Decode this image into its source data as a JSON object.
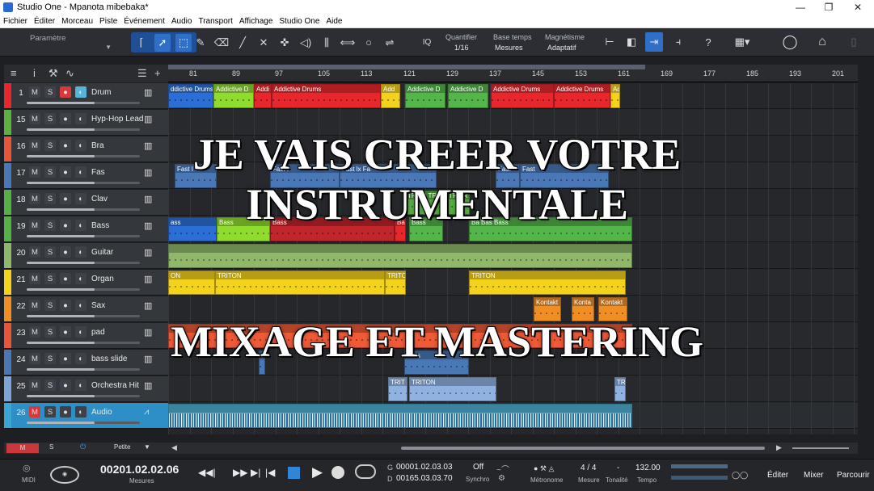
{
  "window": {
    "title": "Studio One - Mpanota mibebaka*",
    "min": "—",
    "max": "❐",
    "close": "✕"
  },
  "menu": [
    "Fichier",
    "Éditer",
    "Morceau",
    "Piste",
    "Événement",
    "Audio",
    "Transport",
    "Affichage",
    "Studio One",
    "Aide"
  ],
  "toolbar": {
    "param_label": "Paramètre",
    "quantize_label": "Quantifier",
    "quantize_value": "1/16",
    "timebase_label": "Base temps",
    "timebase_value": "Mesures",
    "snap_label": "Magnétisme",
    "snap_value": "Adaptatif",
    "iq_label": "IQ"
  },
  "ruler": [
    "81",
    "89",
    "97",
    "105",
    "113",
    "121",
    "129",
    "137",
    "145",
    "153",
    "161",
    "169",
    "177",
    "185",
    "193",
    "201"
  ],
  "tracks": [
    {
      "num": "1",
      "name": "Drum",
      "color": "#e8272d",
      "rec": true,
      "mon": true
    },
    {
      "num": "15",
      "name": "Hyp-Hop Lead",
      "color": "#5fb13f",
      "rec": false,
      "mon": false
    },
    {
      "num": "16",
      "name": "Bra",
      "color": "#e8563a",
      "rec": false,
      "mon": false
    },
    {
      "num": "17",
      "name": "Fas",
      "color": "#4a78b6",
      "rec": false,
      "mon": false
    },
    {
      "num": "18",
      "name": "Clav",
      "color": "#57b044",
      "rec": false,
      "mon": false
    },
    {
      "num": "19",
      "name": "Bass",
      "color": "#57b044",
      "rec": false,
      "mon": false
    },
    {
      "num": "20",
      "name": "Guitar",
      "color": "#8fb86a",
      "rec": false,
      "mon": false
    },
    {
      "num": "21",
      "name": "Organ",
      "color": "#f3d21b",
      "rec": false,
      "mon": false
    },
    {
      "num": "22",
      "name": "Sax",
      "color": "#f08e24",
      "rec": false,
      "mon": false
    },
    {
      "num": "23",
      "name": "pad",
      "color": "#e8563a",
      "rec": false,
      "mon": false
    },
    {
      "num": "24",
      "name": "bass slide",
      "color": "#4a78b6",
      "rec": false,
      "mon": false
    },
    {
      "num": "25",
      "name": "Orchestra Hit",
      "color": "#7ea4d6",
      "rec": false,
      "mon": false
    },
    {
      "num": "26",
      "name": "Audio",
      "color": "#3aa6d2",
      "rec": false,
      "mon": false,
      "selected": true
    }
  ],
  "track_buttons": {
    "mute": "M",
    "solo": "S",
    "record": "●",
    "monitor": "◐"
  },
  "clips": [
    {
      "lane": 0,
      "items": [
        {
          "label": "ddictive Drums",
          "color": "#2b6fd6"
        },
        {
          "label": "Addictive D",
          "color": "#8fdb2e"
        },
        {
          "label": "Addi",
          "color": "#e8272d"
        },
        {
          "label": "Addictive Drums",
          "color": "#e8272d"
        },
        {
          "label": "Add",
          "color": "#f3d21b"
        },
        {
          "label": "Addictive D",
          "color": "#53b54a"
        },
        {
          "label": "Addictive D",
          "color": "#53b54a"
        },
        {
          "label": "Addictive Drums",
          "color": "#e8272d"
        },
        {
          "label": "Addictive Drums",
          "color": "#e8272d"
        },
        {
          "label": "Ad",
          "color": "#f3d21b"
        }
      ]
    },
    {
      "lane": 3,
      "items": [
        {
          "label": "Fast I",
          "color": "#4a78b6"
        },
        {
          "label": "Fast I",
          "color": "#4a78b6"
        },
        {
          "label": "Fast lx Fa",
          "color": "#4a78b6"
        },
        {
          "label": "Fast",
          "color": "#4a78b6"
        },
        {
          "label": "Fast",
          "color": "#4a78b6"
        }
      ]
    },
    {
      "lane": 4,
      "items": [
        {
          "label": "TR TR TR TR TR TR",
          "color": "#57b044"
        }
      ]
    },
    {
      "lane": 5,
      "items": [
        {
          "label": "ass",
          "color": "#2b6fd6"
        },
        {
          "label": "Bass",
          "color": "#8fdb2e"
        },
        {
          "label": "Bass",
          "color": "#c0262c"
        },
        {
          "label": "Ba",
          "color": "#e8272d"
        },
        {
          "label": "Bass",
          "color": "#53b54a"
        },
        {
          "label": "Ba Bas Bass",
          "color": "#53b54a"
        }
      ]
    },
    {
      "lane": 6,
      "items": [
        {
          "label": "",
          "color": "#8fb86a"
        }
      ]
    },
    {
      "lane": 7,
      "items": [
        {
          "label": "ON",
          "color": "#f3d21b"
        },
        {
          "label": "TRITON",
          "color": "#f3d21b"
        },
        {
          "label": "TRITO",
          "color": "#f3d21b"
        },
        {
          "label": "TRITON",
          "color": "#f3d21b"
        }
      ]
    },
    {
      "lane": 8,
      "items": [
        {
          "label": "Kontakt",
          "color": "#f08e24"
        },
        {
          "label": "Konta",
          "color": "#f08e24"
        },
        {
          "label": "Kontakt",
          "color": "#f08e24"
        }
      ]
    },
    {
      "lane": 9,
      "items": [
        {
          "label": "",
          "color": "#ef5a37"
        }
      ]
    },
    {
      "lane": 10,
      "items": [
        {
          "label": "",
          "color": "#4a78b6"
        },
        {
          "label": "bass",
          "color": "#4a78b6"
        }
      ]
    },
    {
      "lane": 11,
      "items": [
        {
          "label": "TRIT",
          "color": "#8fb2e0"
        },
        {
          "label": "TRITON",
          "color": "#8fb2e0"
        },
        {
          "label": "TR",
          "color": "#8fb2e0"
        }
      ]
    },
    {
      "lane": 12,
      "items": [
        {
          "label": "",
          "color": "#4fb0d6"
        }
      ]
    }
  ],
  "footer": {
    "m": "M",
    "s": "S",
    "size": "Petite"
  },
  "transport": {
    "midi_label": "MIDI",
    "position": "00201.02.02.06",
    "position_unit": "Mesures",
    "g_label": "G",
    "g_value": "00001.02.03.03",
    "d_label": "D",
    "d_value": "00165.03.03.70",
    "sync_value": "Off",
    "sync_label": "Synchro",
    "metronome_label": "Métronome",
    "signature": "4 / 4",
    "measure_label": "Mesure",
    "key_value": "-",
    "key_label": "Tonalité",
    "tempo_value": "132.00",
    "tempo_label": "Tempo",
    "edit_btn": "Éditer",
    "mix_btn": "Mixer",
    "browse_btn": "Parcourir"
  },
  "overlay": {
    "line1": "JE VAIS CREER VOTRE INSTRUMENTALE",
    "line2": "MIXAGE ET MASTERING"
  }
}
